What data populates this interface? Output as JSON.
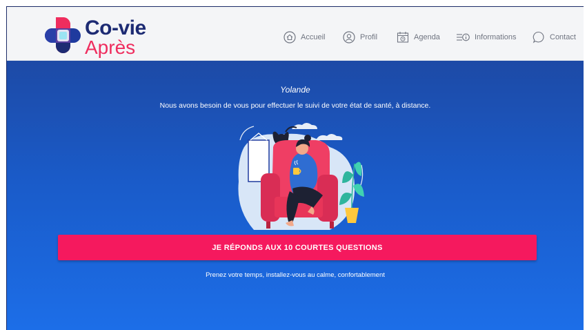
{
  "brand": {
    "name_line1": "Co-vie",
    "name_line2": "Après",
    "colors": {
      "navy": "#1d2b73",
      "pink": "#ef2d5e",
      "cyan": "#2fc1e6"
    }
  },
  "nav": {
    "items": [
      {
        "label": "Accueil",
        "icon": "home-icon"
      },
      {
        "label": "Profil",
        "icon": "user-icon"
      },
      {
        "label": "Agenda",
        "icon": "calendar-icon"
      },
      {
        "label": "Informations",
        "icon": "info-list-icon"
      },
      {
        "label": "Contact",
        "icon": "chat-bubble-icon"
      }
    ]
  },
  "main": {
    "user_name": "Yolande",
    "subtitle": "Nous avons besoin de vous pour effectuer le suivi de votre état de santé, à distance.",
    "cta_label": "JE RÉPONDS AUX 10 COURTES QUESTIONS",
    "hint": "Prenez votre temps, installez-vous au calme, confortablement",
    "illustration": "woman-armchair-illustration",
    "colors": {
      "background_top": "#1d4aa6",
      "background_bottom": "#1c6ee8",
      "cta": "#f5195e"
    }
  }
}
